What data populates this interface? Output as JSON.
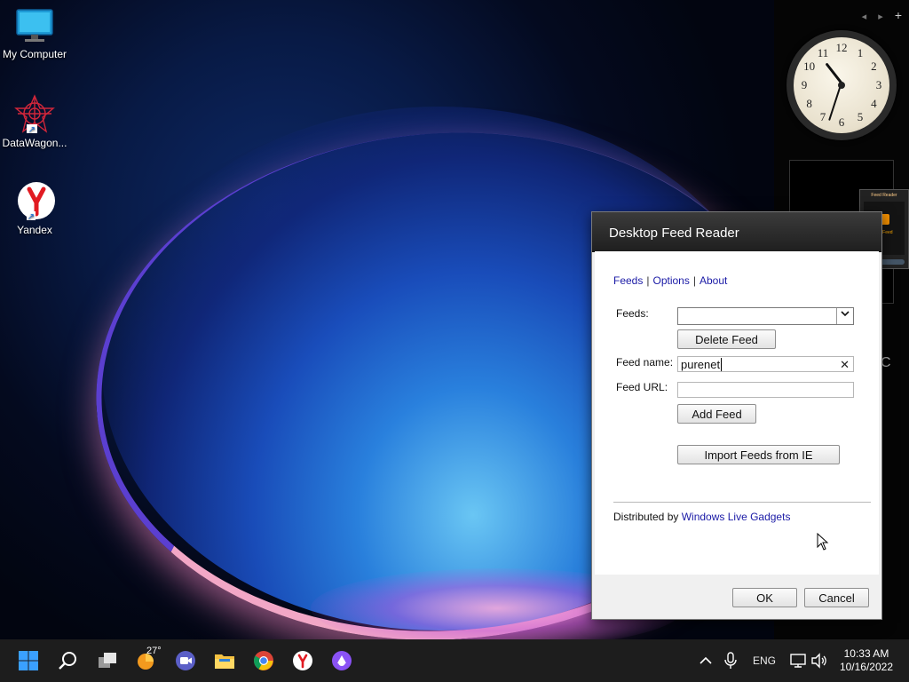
{
  "desktop": {
    "icons": [
      {
        "label": "My Computer"
      },
      {
        "label": "DataWagon..."
      },
      {
        "label": "Yandex"
      }
    ]
  },
  "sidebar": {
    "nav_prev": "◂",
    "nav_next": "▸",
    "nav_add": "+",
    "clock_numbers": [
      "12",
      "1",
      "2",
      "3",
      "4",
      "5",
      "6",
      "7",
      "8",
      "9",
      "10",
      "11"
    ],
    "mini_gadget_title": "Feed Reader",
    "mini_gadget_status": "No Feed",
    "partial_text": "C"
  },
  "dialog": {
    "title": "Desktop Feed Reader",
    "links": {
      "feeds": "Feeds",
      "options": "Options",
      "about": "About",
      "separator": "|"
    },
    "feeds_label": "Feeds:",
    "feeds_selected": "",
    "delete_feed": "Delete Feed",
    "feed_name_label": "Feed name:",
    "feed_name_value": "purenet",
    "feed_url_label": "Feed URL:",
    "feed_url_value": "",
    "add_feed": "Add Feed",
    "import_feeds": "Import Feeds from IE",
    "distributed_by": "Distributed by",
    "distributed_link": "Windows Live Gadgets",
    "ok": "OK",
    "cancel": "Cancel"
  },
  "taskbar": {
    "weather_temp": "27°",
    "language": "ENG",
    "time": "10:33 AM",
    "date": "10/16/2022"
  }
}
